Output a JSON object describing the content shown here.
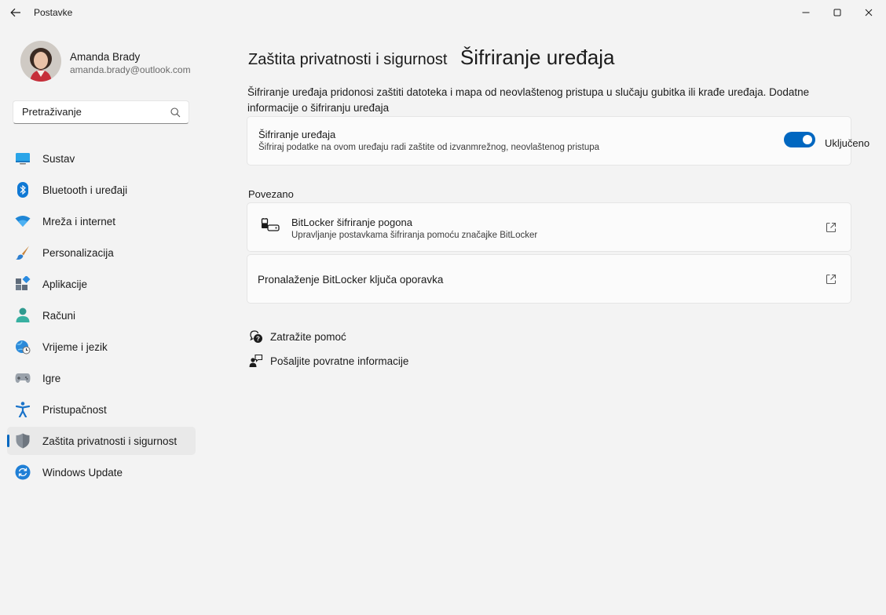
{
  "window": {
    "title": "Postavke"
  },
  "profile": {
    "name": "Amanda Brady",
    "email": "amanda.brady@outlook.com"
  },
  "search": {
    "placeholder": "Pretraživanje"
  },
  "sidebar": {
    "items": [
      {
        "label": "Sustav",
        "icon": "monitor-icon"
      },
      {
        "label": "Bluetooth i uređaji",
        "icon": "bluetooth-icon"
      },
      {
        "label": "Mreža i internet",
        "icon": "wifi-icon"
      },
      {
        "label": "Personalizacija",
        "icon": "brush-icon"
      },
      {
        "label": "Aplikacije",
        "icon": "apps-icon"
      },
      {
        "label": "Računi",
        "icon": "person-icon"
      },
      {
        "label": "Vrijeme i jezik",
        "icon": "globe-clock-icon"
      },
      {
        "label": "Igre",
        "icon": "gamepad-icon"
      },
      {
        "label": "Pristupačnost",
        "icon": "accessibility-icon"
      },
      {
        "label": "Zaštita privatnosti i sigurnost",
        "icon": "shield-icon",
        "selected": true
      },
      {
        "label": "Windows Update",
        "icon": "update-icon"
      }
    ]
  },
  "breadcrumb": {
    "parent": "Zaštita privatnosti i sigurnost",
    "current": "Šifriranje uređaja"
  },
  "description": "Šifriranje uređaja pridonosi zaštiti datoteka i mapa od neovlaštenog pristupa u slučaju gubitka ili krađe uređaja. Dodatne informacije o šifriranju uređaja",
  "encryption_card": {
    "title": "Šifriranje uređaja",
    "subtitle": "Šifriraj podatke na ovom uređaju radi zaštite od izvanmrežnog, neovlaštenog pristupa",
    "toggle_state": "Uključeno",
    "enabled": true
  },
  "related": {
    "header": "Povezano",
    "items": [
      {
        "title": "BitLocker šifriranje pogona",
        "subtitle": "Upravljanje postavkama šifriranja pomoću značajke BitLocker",
        "icon": "bitlocker-drive-icon"
      },
      {
        "title": "Pronalaženje BitLocker ključa oporavka",
        "icon": "external-link-icon"
      }
    ]
  },
  "help": {
    "get_help": "Zatražite pomoć",
    "feedback": "Pošaljite povratne informacije"
  },
  "colors": {
    "accent": "#0067c0",
    "background": "#f3f3f3",
    "card": "#fbfbfb"
  }
}
